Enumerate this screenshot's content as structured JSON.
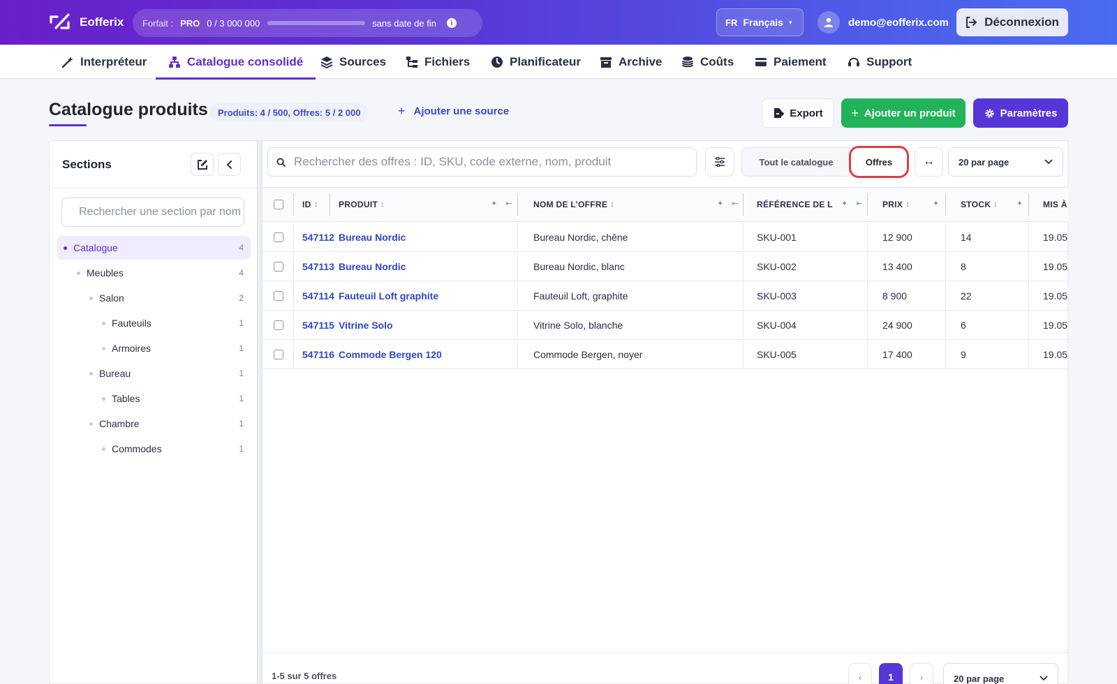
{
  "app": {
    "name": "Eofferix"
  },
  "plan": {
    "label": "Forfait :",
    "tier": "PRO",
    "used": "0",
    "separator": "/",
    "limit": "3 000 000",
    "fill_fraction": 0.0,
    "end": "sans date de fin",
    "info_icon": "info-icon"
  },
  "lang": {
    "code": "FR",
    "name": "Français",
    "caret": "▾"
  },
  "user": {
    "email": "demo@eofferix.com"
  },
  "logout": {
    "label": "Déconnexion"
  },
  "nav": [
    {
      "label": "Interpréteur",
      "icon": "wand-icon"
    },
    {
      "label": "Catalogue consolidé",
      "icon": "sitemap-icon",
      "active": true
    },
    {
      "label": "Sources",
      "icon": "layers-icon"
    },
    {
      "label": "Fichiers",
      "icon": "folder-tree-icon"
    },
    {
      "label": "Planificateur",
      "icon": "clock-icon"
    },
    {
      "label": "Archive",
      "icon": "archive-icon"
    },
    {
      "label": "Coûts",
      "icon": "coins-icon"
    },
    {
      "label": "Paiement",
      "icon": "credit-card-icon"
    },
    {
      "label": "Support",
      "icon": "headset-icon"
    }
  ],
  "page": {
    "title": "Catalogue produits",
    "counts": "Produits: 4 / 500, Offres: 5 / 2 000",
    "add_source": "Ajouter une source",
    "export": "Export",
    "add_product": "Ajouter un produit",
    "params": "Paramètres"
  },
  "sidebar": {
    "title": "Sections",
    "search_placeholder": "Rechercher une section par nom",
    "tree": [
      {
        "label": "Catalogue",
        "count": "4",
        "level": 0,
        "active": true
      },
      {
        "label": "Meubles",
        "count": "4",
        "level": 1
      },
      {
        "label": "Salon",
        "count": "2",
        "level": 2
      },
      {
        "label": "Fauteuils",
        "count": "1",
        "level": 3
      },
      {
        "label": "Armoires",
        "count": "1",
        "level": 3
      },
      {
        "label": "Bureau",
        "count": "1",
        "level": 2
      },
      {
        "label": "Tables",
        "count": "1",
        "level": 3
      },
      {
        "label": "Chambre",
        "count": "1",
        "level": 2
      },
      {
        "label": "Commodes",
        "count": "1",
        "level": 3
      }
    ]
  },
  "toolbar": {
    "search_placeholder": "Rechercher des offres : ID, SKU, code externe, nom, produit",
    "mode_all": "Tout le catalogue",
    "mode_offers": "Offres",
    "per_page": "20 par page"
  },
  "table": {
    "columns": [
      "ID",
      "PRODUIT",
      "NOM DE L’OFFRE",
      "RÉFÉRENCE DE L",
      "PRIX",
      "STOCK",
      "MIS À"
    ],
    "rows": [
      {
        "id": "547112",
        "product": "Bureau Nordic",
        "offer": "Bureau Nordic, chêne",
        "ref": "SKU-001",
        "price": "12 900",
        "stock": "14",
        "updated": "19.05"
      },
      {
        "id": "547113",
        "product": "Bureau Nordic",
        "offer": "Bureau Nordic, blanc",
        "ref": "SKU-002",
        "price": "13 400",
        "stock": "8",
        "updated": "19.05"
      },
      {
        "id": "547114",
        "product": "Fauteuil Loft graphite",
        "offer": "Fauteuil Loft, graphite",
        "ref": "SKU-003",
        "price": "8 900",
        "stock": "22",
        "updated": "19.05"
      },
      {
        "id": "547115",
        "product": "Vitrine Solo",
        "offer": "Vitrine Solo, blanche",
        "ref": "SKU-004",
        "price": "24 900",
        "stock": "6",
        "updated": "19.05"
      },
      {
        "id": "547116",
        "product": "Commode Bergen 120",
        "offer": "Commode Bergen, noyer",
        "ref": "SKU-005",
        "price": "17 400",
        "stock": "9",
        "updated": "19.05"
      }
    ]
  },
  "footer": {
    "range": "1-5 sur 5 offres",
    "prev": "‹",
    "page": "1",
    "next": "›",
    "per_page": "20 par page"
  },
  "colors": {
    "brand": "#5b2fd4",
    "add_green": "#22b35a",
    "highlight": "#e23b45",
    "link": "#2f47c3"
  }
}
